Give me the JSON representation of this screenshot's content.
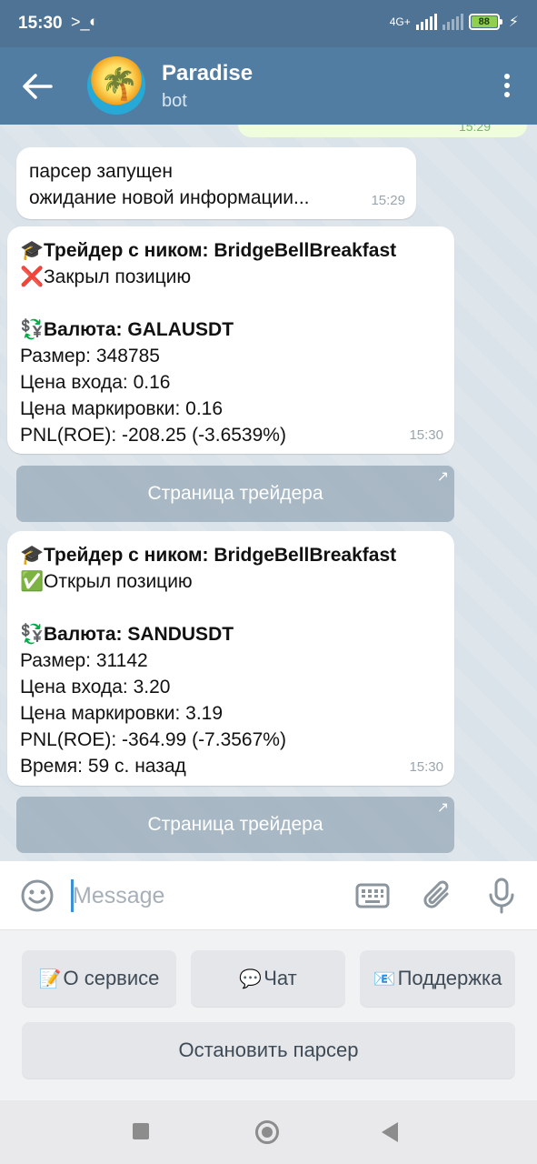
{
  "status_bar": {
    "time": "15:30",
    "network_label": "4G+",
    "battery": "88",
    "icons": [
      "terminal-icon",
      "app-notification-icon",
      "signal-icon",
      "battery-icon",
      "charging-icon"
    ]
  },
  "header": {
    "title": "Paradise",
    "subtitle": "bot"
  },
  "chat": {
    "outgoing_time": "15:29",
    "messages": [
      {
        "lines": [
          "парсер запущен",
          "ожидание новой информации..."
        ],
        "time": "15:29"
      },
      {
        "trader_emoji": "🎓",
        "trader": "Трейдер с ником: BridgeBellBreakfast",
        "action_emoji": "❌",
        "action": "Закрыл позицию",
        "currency_emoji": "💱",
        "currency": "Валюта: GALAUSDT",
        "size": "Размер: 348785",
        "entry": "Цена входа: 0.16",
        "mark": "Цена маркировки: 0.16",
        "pnl": "PNL(ROE): -208.25 (-3.6539%)",
        "time": "15:30",
        "button": "Страница трейдера"
      },
      {
        "trader_emoji": "🎓",
        "trader": "Трейдер с ником: BridgeBellBreakfast",
        "action_emoji": "✅",
        "action": "Открыл позицию",
        "currency_emoji": "💱",
        "currency": "Валюта: SANDUSDT",
        "size": "Размер: 31142",
        "entry": "Цена входа: 3.20",
        "mark": "Цена маркировки: 3.19",
        "pnl": "PNL(ROE): -364.99 (-7.3567%)",
        "time_ago": "Время: 59 с. назад",
        "time": "15:30",
        "button": "Страница трейдера"
      }
    ]
  },
  "input": {
    "placeholder": "Message"
  },
  "keyboard": {
    "about": {
      "emoji": "📝",
      "label": "О сервисе"
    },
    "chat": {
      "emoji": "💬",
      "label": "Чат"
    },
    "support": {
      "emoji": "📧",
      "label": "Поддержка"
    },
    "stop": {
      "label": "Остановить парсер"
    }
  }
}
